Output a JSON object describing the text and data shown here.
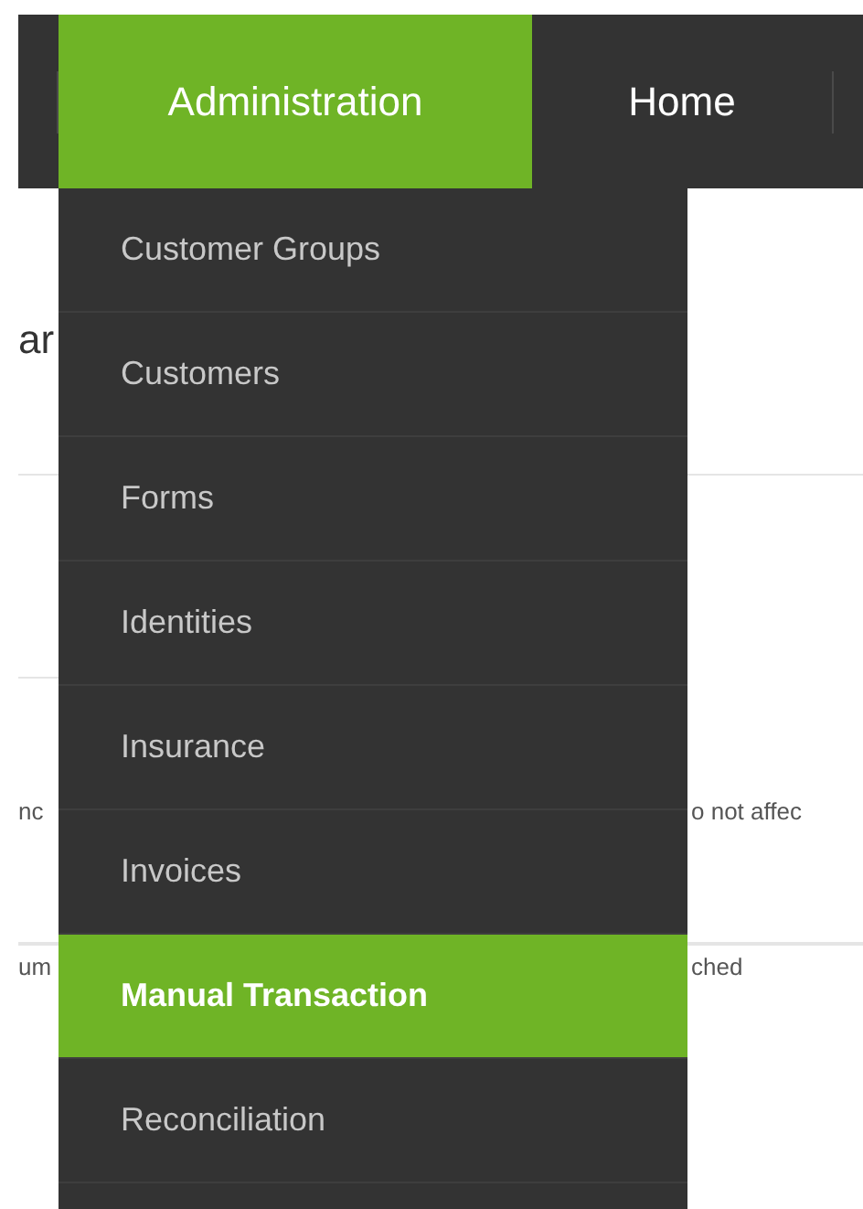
{
  "nav": {
    "tabs": [
      {
        "label": "Administration",
        "selected": true
      },
      {
        "label": "Home",
        "selected": false
      }
    ]
  },
  "dropdown": {
    "items": [
      {
        "label": "Customer Groups",
        "selected": false
      },
      {
        "label": "Customers",
        "selected": false
      },
      {
        "label": "Forms",
        "selected": false
      },
      {
        "label": "Identities",
        "selected": false
      },
      {
        "label": "Insurance",
        "selected": false
      },
      {
        "label": "Invoices",
        "selected": false
      },
      {
        "label": "Manual Transaction",
        "selected": true
      },
      {
        "label": "Reconciliation",
        "selected": false
      }
    ]
  },
  "page": {
    "heading": "ar",
    "rows": [
      {
        "left": "nc",
        "right": "o not affec"
      },
      {
        "left": "um",
        "right": "ched"
      }
    ]
  }
}
